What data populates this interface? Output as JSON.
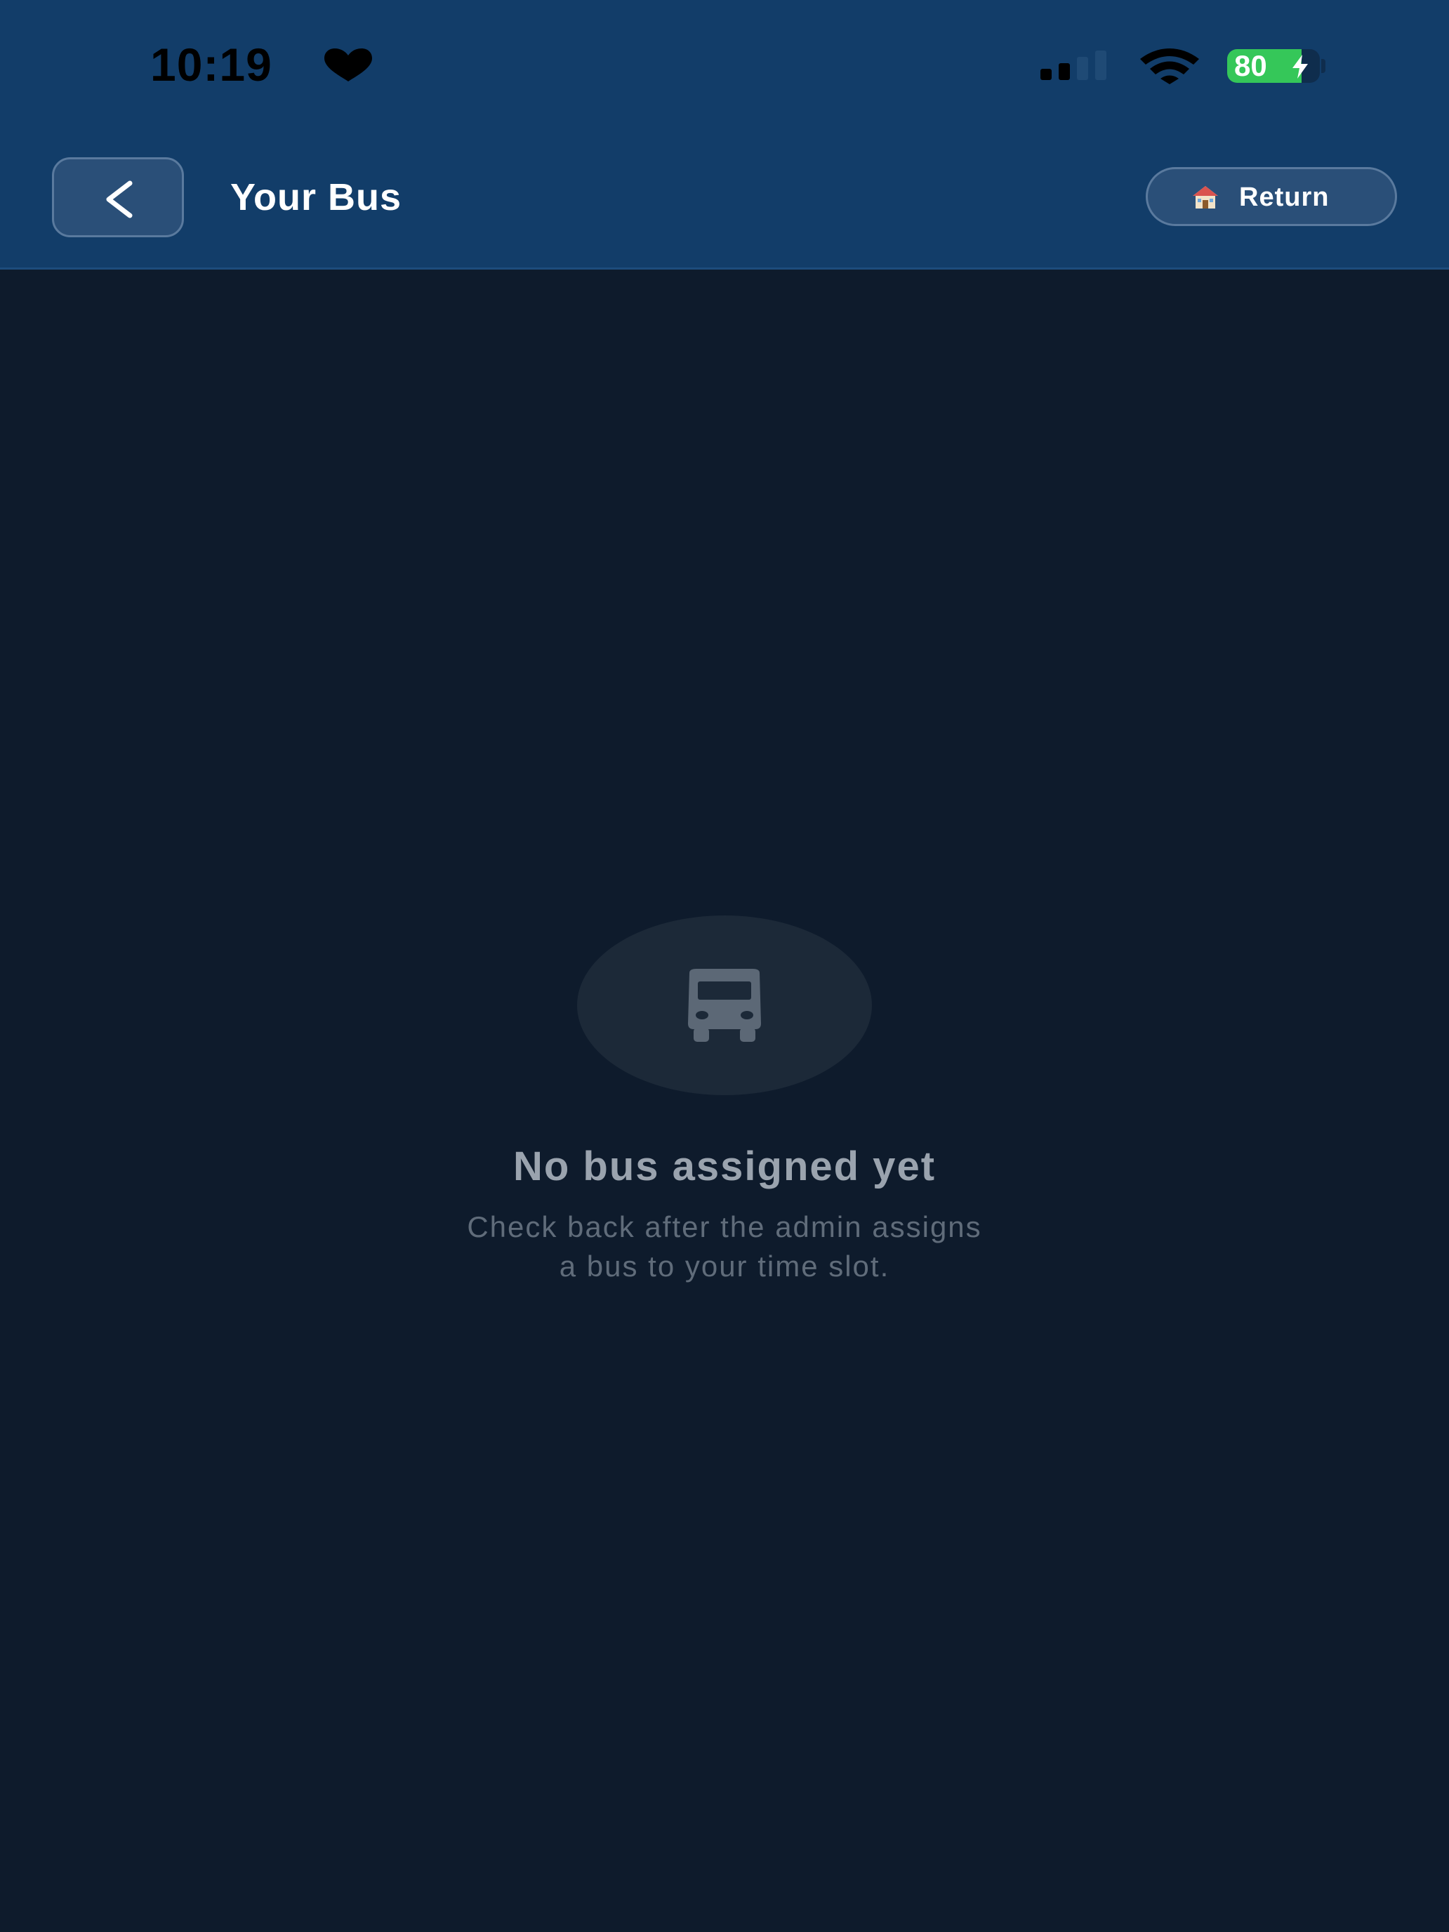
{
  "status_bar": {
    "time": "10:19",
    "battery_percent": "80",
    "battery_level": 0.8,
    "icons": [
      "heart-icon",
      "cellular-signal-icon",
      "wifi-icon",
      "charging-bolt-icon"
    ]
  },
  "nav": {
    "back_icon": "chevron-left-icon",
    "title": "Your Bus",
    "return_button": {
      "icon": "house-icon",
      "label": "Return"
    }
  },
  "empty_state": {
    "icon": "bus-icon",
    "title": "No bus assigned yet",
    "subtitle_line1": "Check back after the admin assigns",
    "subtitle_line2": "a bus to your time slot."
  },
  "colors": {
    "header_bg": "#123d69",
    "page_bg": "#0e1b2c",
    "battery_green": "#35c759"
  }
}
